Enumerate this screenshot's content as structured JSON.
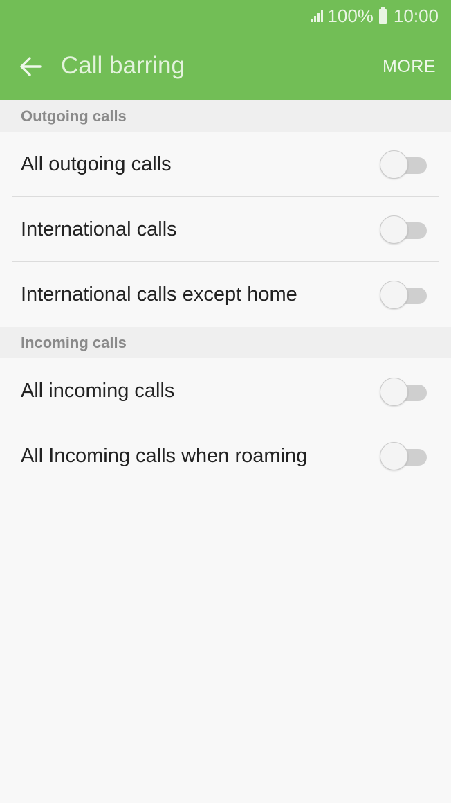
{
  "status_bar": {
    "battery": "100%",
    "time": "10:00"
  },
  "app_bar": {
    "title": "Call barring",
    "more_label": "MORE"
  },
  "sections": [
    {
      "header": "Outgoing calls",
      "items": [
        {
          "label": "All outgoing calls",
          "enabled": false
        },
        {
          "label": "International calls",
          "enabled": false
        },
        {
          "label": "International calls except home",
          "enabled": false
        }
      ]
    },
    {
      "header": "Incoming calls",
      "items": [
        {
          "label": "All incoming calls",
          "enabled": false
        },
        {
          "label": "All Incoming calls when roaming",
          "enabled": false
        }
      ]
    }
  ],
  "colors": {
    "accent": "#72be56",
    "background": "#f8f8f8",
    "section_bg": "#efefef"
  }
}
